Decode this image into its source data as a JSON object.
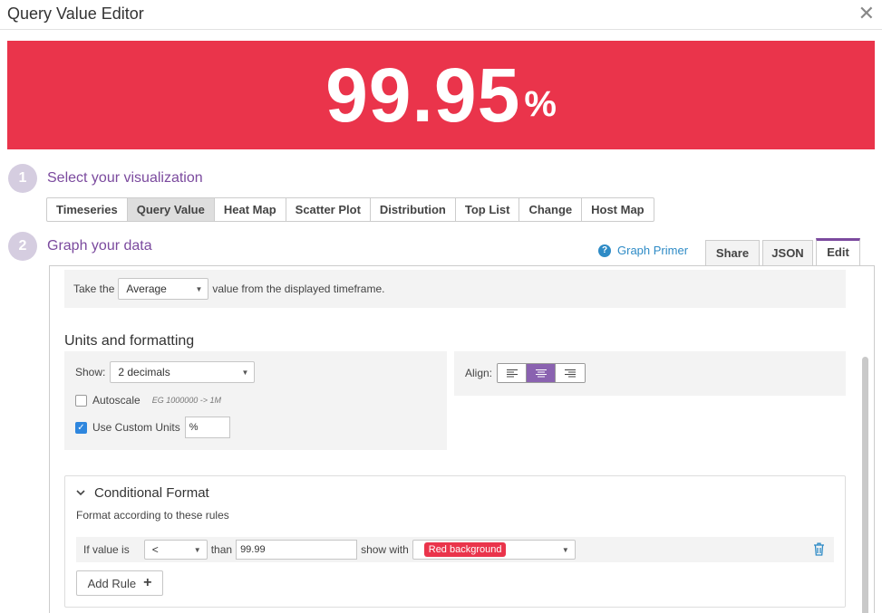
{
  "window": {
    "title": "Query Value Editor",
    "close_label": "✕"
  },
  "banner": {
    "value": "99.95",
    "unit": "%",
    "color": "#ea344b"
  },
  "step1": {
    "number": "1",
    "label": "Select your visualization"
  },
  "visualization_tabs": [
    {
      "label": "Timeseries",
      "active": false
    },
    {
      "label": "Query Value",
      "active": true
    },
    {
      "label": "Heat Map",
      "active": false
    },
    {
      "label": "Scatter Plot",
      "active": false
    },
    {
      "label": "Distribution",
      "active": false
    },
    {
      "label": "Top List",
      "active": false
    },
    {
      "label": "Change",
      "active": false
    },
    {
      "label": "Host Map",
      "active": false
    }
  ],
  "step2": {
    "number": "2",
    "label": "Graph your data"
  },
  "graph_primer": {
    "icon": "?",
    "label": "Graph Primer"
  },
  "editor_tabs": {
    "share": "Share",
    "json": "JSON",
    "edit": "Edit"
  },
  "aggregation": {
    "prefix": "Take the",
    "selected": "Average",
    "suffix": "value from the displayed timeframe."
  },
  "units": {
    "title": "Units and formatting",
    "show_label": "Show:",
    "show_value": "2 decimals",
    "autoscale_label": "Autoscale",
    "autoscale_hint": "EG 1000000 -> 1M",
    "autoscale_checked": false,
    "custom_units_label": "Use Custom Units",
    "custom_units_checked": true,
    "custom_units_value": "%",
    "align_label": "Align:",
    "align_selected": "center"
  },
  "conditional_format": {
    "title": "Conditional Format",
    "subtitle": "Format according to these rules",
    "rule": {
      "if_label": "If value is",
      "comparator": "<",
      "than_label": "than",
      "threshold": "99.99",
      "show_with_label": "show with",
      "style": "Red background"
    },
    "add_rule_label": "Add Rule",
    "add_icon": "+"
  },
  "colors": {
    "accent": "#7b4a9e",
    "link": "#2e8bc6",
    "alert": "#ea344b"
  }
}
